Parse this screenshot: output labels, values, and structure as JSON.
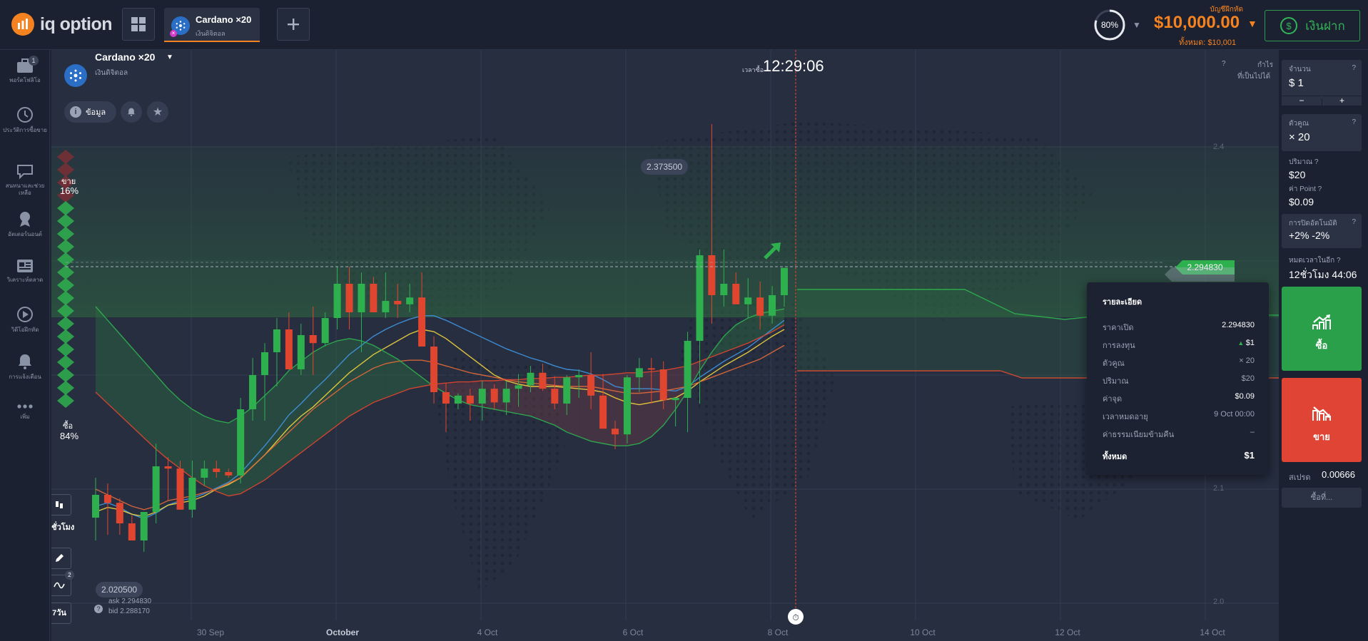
{
  "app": {
    "brand": "iq option"
  },
  "asset_tab": {
    "name": "Cardano ×20",
    "type": "เงินดิจิตอล"
  },
  "header": {
    "balance_label": "บัญชีฝึกหัด",
    "balance": "$10,000.00",
    "balance_total": "ทั้งหมด: $10,001",
    "deposit": "เงินฝาก",
    "gauge_value": "80%"
  },
  "sidebar": {
    "items": [
      {
        "label": "พอร์ตโฟลิโอ",
        "badge": "1",
        "icon": "briefcase-icon"
      },
      {
        "label": "ประวัติการซื้อขาย",
        "icon": "history-icon"
      },
      {
        "label": "สนทนาและช่วยเหลือ",
        "icon": "chat-icon"
      },
      {
        "label": "อัตเตอร์นอนต์",
        "icon": "trophy-icon"
      },
      {
        "label": "วิเคราะห์ตลาด",
        "icon": "news-icon"
      },
      {
        "label": "วิดีโอฝึกหัด",
        "icon": "play-icon"
      },
      {
        "label": "การแจ้งเตือน",
        "icon": "bell-icon"
      },
      {
        "label": "เพิ่ม",
        "icon": "more-icon"
      }
    ]
  },
  "chart": {
    "asset_name": "Cardano ×20",
    "asset_type": "เงินดิจิตอล",
    "info_label": "ข้อมูล",
    "time_label": "เวลาซื้อ",
    "time": "12:29:06",
    "profit_label": "กำไร",
    "profit_sub": "ที่เป็นไปได้",
    "sell_label": "ขาย",
    "sell_pct": "16%",
    "buy_label": "ซื้อ",
    "buy_pct": "84%",
    "high_label": "2.373500",
    "low_label": "2.020500",
    "current_price": "2.294830",
    "ask": "ask 2.294830",
    "bid": "bid 2.288170",
    "period": "4ชั่วโมง",
    "range": "7วัน",
    "indicator_badge": "2",
    "y_ticks": [
      "2.4",
      "2.1",
      "2.0"
    ],
    "x_ticks": [
      "30 Sep",
      "October",
      "4 Oct",
      "6 Oct",
      "8 Oct",
      "10 Oct",
      "12 Oct",
      "14 Oct"
    ]
  },
  "detail": {
    "title": "รายละเอียด",
    "rows": [
      {
        "k": "ราคาเปิด",
        "v": "2.294830"
      },
      {
        "k": "การลงทุน",
        "v": "$1"
      },
      {
        "k": "ตัวคูณ",
        "v": "× 20"
      },
      {
        "k": "ปริมาณ",
        "v": "$20"
      },
      {
        "k": "ค่าจุด",
        "v": "$0.09"
      },
      {
        "k": "เวลาหมดอายุ",
        "v": "9 Oct 00:00"
      },
      {
        "k": "ค่าธรรมเนียมข้ามคืน",
        "v": "–"
      }
    ],
    "total_label": "ทั้งหมด",
    "total": "$1"
  },
  "right_panel": {
    "amount_label": "จำนวน",
    "amount": "$ 1",
    "minus": "−",
    "plus": "+",
    "multiplier_label": "ตัวคูณ",
    "multiplier": "× 20",
    "volume_label": "ปริมาณ",
    "volume": "$20",
    "point_label": "ค่า Point",
    "point": "$0.09",
    "autoclose_label": "การปิดอัตโนมัติ",
    "autoclose": "+2% -2%",
    "expire_label": "หมดเวลาในอีก",
    "expire": "12ชั่วโมง 44:06",
    "buy": "ซื้อ",
    "sell": "ขาย",
    "spread_label": "สเปรด",
    "spread": "0.00666",
    "more": "ซื้อที่..."
  },
  "chart_data": {
    "type": "candlestick",
    "x": [
      "29 Sep 00:00",
      "29 Sep 04:00",
      "29 Sep 08:00",
      "29 Sep 12:00",
      "29 Sep 16:00",
      "29 Sep 20:00",
      "30 Sep 00:00",
      "30 Sep 04:00",
      "30 Sep 08:00",
      "30 Sep 12:00",
      "30 Sep 16:00",
      "30 Sep 20:00",
      "1 Oct 00:00",
      "1 Oct 04:00",
      "1 Oct 08:00",
      "1 Oct 12:00",
      "1 Oct 16:00",
      "1 Oct 20:00",
      "2 Oct 00:00",
      "2 Oct 04:00",
      "2 Oct 08:00",
      "2 Oct 12:00",
      "2 Oct 16:00",
      "2 Oct 20:00",
      "3 Oct 00:00",
      "3 Oct 04:00",
      "3 Oct 08:00",
      "3 Oct 12:00",
      "3 Oct 16:00",
      "3 Oct 20:00",
      "4 Oct 00:00",
      "4 Oct 04:00",
      "4 Oct 08:00",
      "4 Oct 12:00",
      "4 Oct 16:00",
      "4 Oct 20:00",
      "5 Oct 00:00",
      "5 Oct 04:00",
      "5 Oct 08:00",
      "5 Oct 12:00",
      "5 Oct 16:00",
      "5 Oct 20:00",
      "6 Oct 00:00",
      "6 Oct 04:00",
      "6 Oct 08:00",
      "6 Oct 12:00",
      "6 Oct 16:00",
      "6 Oct 20:00",
      "7 Oct 00:00",
      "7 Oct 04:00",
      "7 Oct 08:00",
      "7 Oct 12:00",
      "7 Oct 16:00",
      "7 Oct 20:00",
      "8 Oct 00:00",
      "8 Oct 04:00",
      "8 Oct 08:00",
      "8 Oct 12:00"
    ],
    "open": [
      2.075,
      2.095,
      2.088,
      2.07,
      2.055,
      2.08,
      2.12,
      2.118,
      2.082,
      2.11,
      2.118,
      2.115,
      2.112,
      2.17,
      2.2,
      2.22,
      2.24,
      2.205,
      2.235,
      2.228,
      2.25,
      2.28,
      2.255,
      2.28,
      2.255,
      2.265,
      2.262,
      2.268,
      2.225,
      2.185,
      2.175,
      2.182,
      2.175,
      2.188,
      2.176,
      2.188,
      2.191,
      2.202,
      2.188,
      2.175,
      2.198,
      2.2,
      2.182,
      2.153,
      2.148,
      2.198,
      2.206,
      2.205,
      2.178,
      2.18,
      2.23,
      2.305,
      2.27,
      2.28,
      2.262,
      2.268,
      2.252,
      2.27
    ],
    "high": [
      2.11,
      2.105,
      2.092,
      2.077,
      2.08,
      2.14,
      2.128,
      2.125,
      2.125,
      2.125,
      2.125,
      2.118,
      2.18,
      2.215,
      2.228,
      2.25,
      2.255,
      2.245,
      2.26,
      2.255,
      2.295,
      2.295,
      2.29,
      2.286,
      2.29,
      2.28,
      2.28,
      2.29,
      2.234,
      2.193,
      2.184,
      2.188,
      2.195,
      2.192,
      2.195,
      2.201,
      2.208,
      2.21,
      2.199,
      2.2,
      2.205,
      2.22,
      2.201,
      2.16,
      2.2,
      2.215,
      2.215,
      2.212,
      2.18,
      2.238,
      2.31,
      2.42,
      2.31,
      2.29,
      2.285,
      2.282,
      2.278,
      2.275
    ],
    "low": [
      2.055,
      2.06,
      2.06,
      2.055,
      2.045,
      2.07,
      2.09,
      2.082,
      2.075,
      2.103,
      2.11,
      2.11,
      2.105,
      2.16,
      2.16,
      2.19,
      2.22,
      2.2,
      2.2,
      2.225,
      2.24,
      2.24,
      2.22,
      2.255,
      2.25,
      2.25,
      2.255,
      2.225,
      2.175,
      2.15,
      2.17,
      2.16,
      2.16,
      2.17,
      2.165,
      2.172,
      2.185,
      2.186,
      2.17,
      2.165,
      2.18,
      2.17,
      2.16,
      2.135,
      2.14,
      2.185,
      2.175,
      2.17,
      2.155,
      2.15,
      2.175,
      2.245,
      2.26,
      2.265,
      2.25,
      2.24,
      2.245,
      2.26
    ],
    "close": [
      2.095,
      2.088,
      2.07,
      2.055,
      2.08,
      2.12,
      2.118,
      2.082,
      2.11,
      2.118,
      2.115,
      2.112,
      2.17,
      2.2,
      2.22,
      2.24,
      2.205,
      2.235,
      2.228,
      2.25,
      2.28,
      2.255,
      2.28,
      2.255,
      2.265,
      2.262,
      2.268,
      2.225,
      2.185,
      2.175,
      2.182,
      2.175,
      2.188,
      2.176,
      2.188,
      2.191,
      2.202,
      2.188,
      2.175,
      2.198,
      2.2,
      2.182,
      2.153,
      2.148,
      2.198,
      2.206,
      2.205,
      2.178,
      2.18,
      2.23,
      2.305,
      2.27,
      2.28,
      2.262,
      2.268,
      2.252,
      2.27,
      2.294
    ],
    "ylim": [
      2.0,
      2.45
    ],
    "y_ticks": [
      2.4,
      2.1,
      2.0
    ],
    "x_ticks": [
      "30 Sep",
      "October",
      "4 Oct",
      "6 Oct",
      "8 Oct",
      "10 Oct",
      "12 Oct",
      "14 Oct"
    ],
    "high_marker": 2.3735,
    "low_marker": 2.0205,
    "current_price": 2.29483,
    "sentiment": {
      "sell_pct": 16,
      "buy_pct": 84
    },
    "colors": {
      "up": "#2fb04f",
      "down": "#e0462f",
      "cloud_up": "#2d6b3f",
      "cloud_down": "#6b3a44"
    },
    "series": [
      {
        "values": [
          2.085,
          2.088,
          2.084,
          2.078,
          2.074,
          2.079,
          2.086,
          2.09,
          2.092,
          2.096,
          2.101,
          2.106,
          2.114,
          2.126,
          2.138,
          2.151,
          2.165,
          2.175,
          2.186,
          2.196,
          2.207,
          2.218,
          2.226,
          2.234,
          2.24,
          2.245,
          2.249,
          2.252,
          2.252,
          2.248,
          2.243,
          2.238,
          2.233,
          2.228,
          2.223,
          2.219,
          2.215,
          2.212,
          2.208,
          2.205,
          2.204,
          2.201,
          2.196,
          2.19,
          2.188,
          2.188,
          2.188,
          2.187,
          2.186,
          2.19,
          2.198,
          2.205,
          2.212,
          2.218,
          2.224,
          2.232,
          2.24,
          2.248
        ]
      },
      {
        "values": [
          2.08,
          2.084,
          2.082,
          2.078,
          2.076,
          2.08,
          2.086,
          2.088,
          2.09,
          2.094,
          2.1,
          2.104,
          2.11,
          2.12,
          2.13,
          2.142,
          2.154,
          2.164,
          2.172,
          2.182,
          2.192,
          2.202,
          2.21,
          2.218,
          2.224,
          2.23,
          2.236,
          2.24,
          2.238,
          2.232,
          2.224,
          2.216,
          2.208,
          2.2,
          2.195,
          2.192,
          2.19,
          2.19,
          2.19,
          2.189,
          2.188,
          2.187,
          2.185,
          2.18,
          2.176,
          2.174,
          2.176,
          2.178,
          2.18,
          2.186,
          2.194,
          2.201,
          2.208,
          2.214,
          2.22,
          2.227,
          2.234,
          2.24
        ]
      },
      {
        "values": [
          2.1,
          2.095,
          2.09,
          2.085,
          2.082,
          2.085,
          2.09,
          2.092,
          2.094,
          2.097,
          2.1,
          2.105,
          2.11,
          2.12,
          2.13,
          2.14,
          2.15,
          2.16,
          2.17,
          2.178,
          2.186,
          2.194,
          2.2,
          2.206,
          2.21,
          2.212,
          2.213,
          2.213,
          2.211,
          2.208,
          2.205,
          2.202,
          2.2,
          2.198,
          2.196,
          2.194,
          2.193,
          2.192,
          2.191,
          2.19,
          2.19,
          2.19,
          2.188,
          2.186,
          2.184,
          2.184,
          2.185,
          2.186,
          2.188,
          2.19,
          2.194,
          2.198,
          2.202,
          2.206,
          2.21,
          2.214,
          2.22,
          2.226
        ]
      },
      {
        "values": [
          2.185,
          2.175,
          2.165,
          2.155,
          2.145,
          2.135,
          2.126,
          2.118,
          2.11,
          2.103,
          2.098,
          2.094,
          2.096,
          2.102,
          2.108,
          2.116,
          2.124,
          2.132,
          2.14,
          2.148,
          2.156,
          2.164,
          2.17,
          2.176,
          2.18,
          2.184,
          2.188,
          2.19,
          2.192,
          2.193,
          2.194,
          2.194,
          2.195,
          2.195,
          2.196,
          2.196,
          2.197,
          2.197,
          2.198,
          2.198,
          2.199,
          2.2,
          2.2,
          2.201,
          2.202,
          2.202,
          2.203,
          2.204,
          2.206,
          2.208,
          2.212,
          2.216,
          2.22,
          2.224,
          2.228,
          2.233,
          2.238,
          2.244
        ]
      },
      {
        "values": [
          2.26,
          2.248,
          2.236,
          2.224,
          2.212,
          2.2,
          2.188,
          2.178,
          2.17,
          2.164,
          2.16,
          2.158,
          2.164,
          2.172,
          2.182,
          2.192,
          2.204,
          2.212,
          2.22,
          2.226,
          2.23,
          2.232,
          2.23,
          2.226,
          2.22,
          2.214,
          2.206,
          2.198,
          2.19,
          2.184,
          2.178,
          2.174,
          2.172,
          2.17,
          2.168,
          2.166,
          2.164,
          2.16,
          2.156,
          2.15,
          2.146,
          2.142,
          2.14,
          2.138,
          2.138,
          2.14,
          2.146,
          2.156,
          2.17,
          2.186,
          2.204,
          2.22,
          2.234,
          2.244,
          2.25,
          2.254,
          2.256,
          2.258
        ]
      }
    ]
  }
}
